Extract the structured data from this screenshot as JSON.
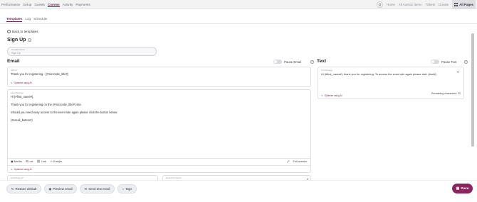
{
  "topnav": {
    "items": [
      "Performance",
      "Setup",
      "Guests",
      "Comms",
      "Activity",
      "Payments"
    ],
    "active_index": 3,
    "right": {
      "home": "Home",
      "all_auction_items": "All Auction Items",
      "tickets": "Tickets",
      "donate": "Donate",
      "all_pages": "All Pages"
    }
  },
  "subtabs": {
    "items": [
      "Templates",
      "Log",
      "Schedule"
    ],
    "active_index": 0
  },
  "back_label": "Back to templates",
  "page_title": "Sign Up",
  "template_name": {
    "label": "Template Name*",
    "value": "Sign Up"
  },
  "email": {
    "title": "Email",
    "pause_label": "Pause Email",
    "subject": {
      "label": "Subject*",
      "value": "Thank you for registering - {#microsite_title#}"
    },
    "optimize_label": "Optimize using AI",
    "message": {
      "label": "Email Message",
      "lines": [
        "Hi {#first_name#},",
        "Thank you for registering on the {#microsite_title#} site.",
        "Should you need easy access to the event site again please click the button below:",
        "{#email_button#}"
      ]
    },
    "toolbar": {
      "media": "Media",
      "list": "List",
      "link": "Link",
      "emojis": "Emojis",
      "fullscreen": "Full screen"
    },
    "optimize_label_2": "Optimize using AI",
    "reply_to_label": "Email Reply To*",
    "from_label": "Email From Name*"
  },
  "text": {
    "title": "Text",
    "pause_label": "Pause Text",
    "message": {
      "label": "Text Message",
      "value": "Hi {#first_name#}, thank you for registering. To access the event site again please visit: {#url#}"
    },
    "optimize_label": "Optimize using AI",
    "remaining": "Remaining characters: 32"
  },
  "footer": {
    "restore": "Restore default",
    "preview": "Preview email",
    "send_test": "Send test email",
    "tags": "Tags",
    "save": "Save"
  },
  "colors": {
    "accent": "#8e245f",
    "accent_dark": "#7a1e57"
  }
}
